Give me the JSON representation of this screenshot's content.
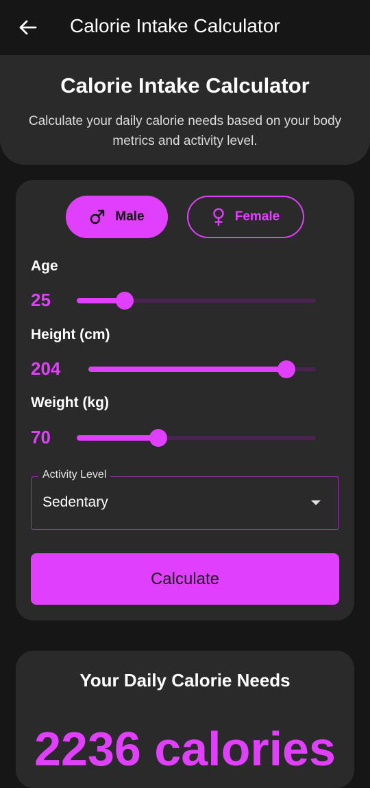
{
  "appbar": {
    "title": "Calorie Intake Calculator"
  },
  "hero": {
    "title": "Calorie Intake Calculator",
    "subtitle": "Calculate your daily calorie needs based on your body metrics and activity level."
  },
  "gender": {
    "male_label": "Male",
    "female_label": "Female",
    "selected": "Male"
  },
  "fields": {
    "age": {
      "label": "Age",
      "value": "25",
      "fill_fraction": 0.2
    },
    "height": {
      "label": "Height (cm)",
      "value": "204",
      "fill_fraction": 0.87
    },
    "weight": {
      "label": "Weight (kg)",
      "value": "70",
      "fill_fraction": 0.34
    }
  },
  "activity": {
    "label": "Activity Level",
    "value": "Sedentary"
  },
  "calculate_label": "Calculate",
  "result": {
    "title": "Your Daily Calorie Needs",
    "value": "2236 calories"
  },
  "colors": {
    "accent": "#e040fb",
    "surface": "#2a2a2a",
    "background": "#161616"
  }
}
